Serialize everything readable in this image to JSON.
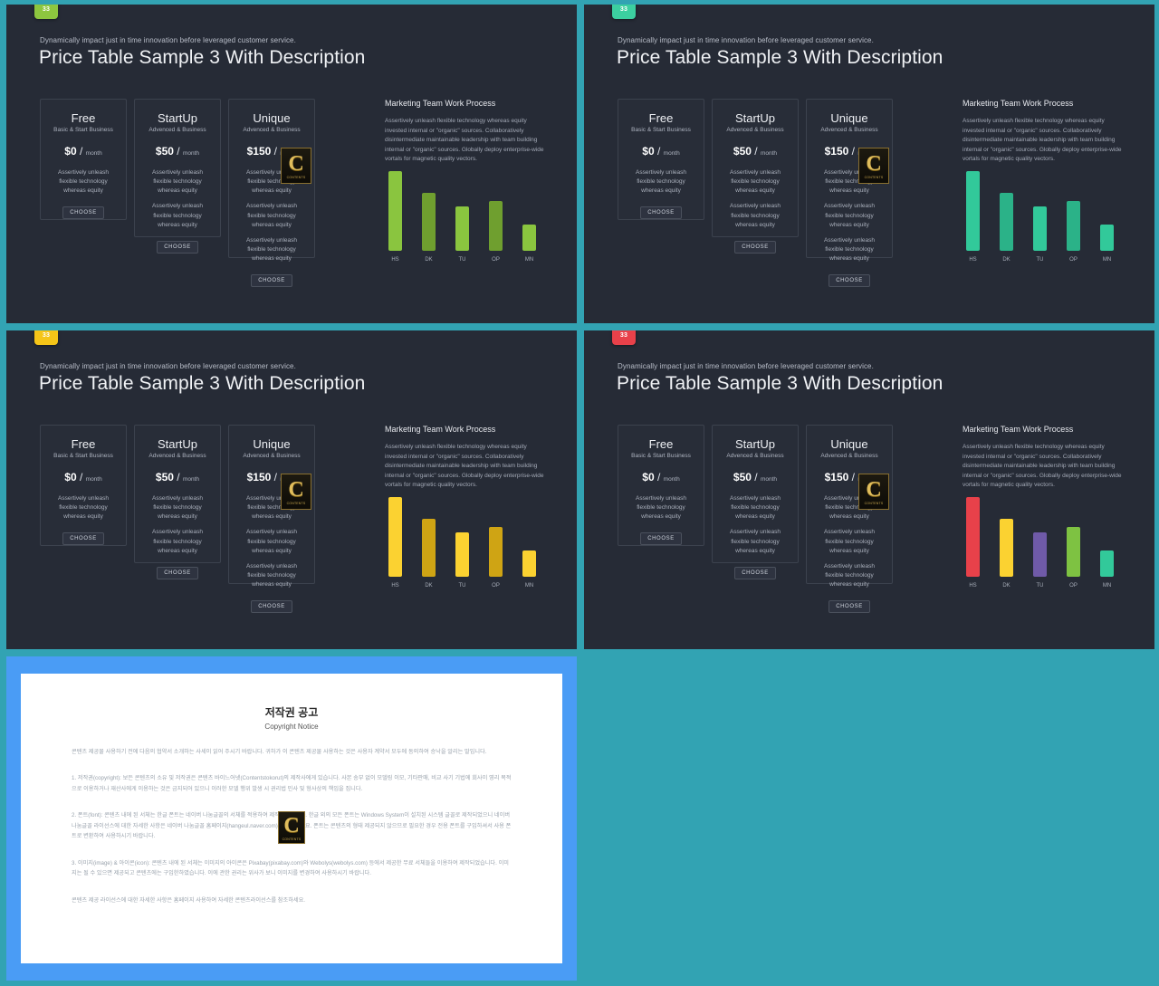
{
  "slide": {
    "kicker": "Dynamically impact just in time innovation  before leveraged customer service.",
    "headline": "Price Table Sample 3 With Description"
  },
  "badges": [
    {
      "label": "33",
      "color": "#8dc63f"
    },
    {
      "label": "33",
      "color": "#3ccfa0"
    },
    {
      "label": "33",
      "color": "#f5c518"
    },
    {
      "label": "33",
      "color": "#e8414a"
    }
  ],
  "cards": [
    {
      "title": "Free",
      "subtitle": "Basic & Start Business",
      "price": "$0",
      "slash": "/",
      "period": "month",
      "features": [
        "Assertively unleash flexible technology whereas equity"
      ],
      "cta": "CHOOSE"
    },
    {
      "title": "StartUp",
      "subtitle": "Advenced & Business",
      "price": "$50",
      "slash": "/",
      "period": "month",
      "features": [
        "Assertively unleash flexible technology whereas equity",
        "Assertively unleash flexible technology whereas equity"
      ],
      "cta": "CHOOSE"
    },
    {
      "title": "Unique",
      "subtitle": "Advenced & Business",
      "price": "$150",
      "slash": "/",
      "period": "month",
      "features": [
        "Assertively unleash flexible technology whereas equity",
        "Assertively unleash flexible technology whereas equity",
        "Assertively unleash flexible technology whereas equity"
      ],
      "cta": "CHOOSE"
    }
  ],
  "watermark": {
    "letter": "C",
    "caption": "CONTENTS"
  },
  "chart_common": {
    "title": "Marketing  Team Work Process",
    "description": "Assertively unleash flexible technology whereas equity invested internal or \"organic\" sources. Collaboratively disintermediate maintainable leadership with team building internal or \"organic\" sources. Globally deploy enterprise-wide vortals for magnetic quality vectors."
  },
  "chart_data": [
    {
      "type": "bar",
      "panel": 1,
      "title": "Marketing  Team Work Process",
      "categories": [
        "HS",
        "DK",
        "TU",
        "OP",
        "MN"
      ],
      "values": [
        100,
        72,
        55,
        62,
        33
      ],
      "colors": [
        "#8ac53f",
        "#6f9f2f",
        "#8ac53f",
        "#6f9f2f",
        "#8ac53f"
      ],
      "ylim": [
        0,
        100
      ],
      "xlabel": "",
      "ylabel": "",
      "grid": false,
      "legend": "none"
    },
    {
      "type": "bar",
      "panel": 2,
      "title": "Marketing  Team Work Process",
      "categories": [
        "HS",
        "DK",
        "TU",
        "OP",
        "MN"
      ],
      "values": [
        100,
        72,
        55,
        62,
        33
      ],
      "colors": [
        "#32c99a",
        "#2bb288",
        "#32c99a",
        "#2bb288",
        "#32c99a"
      ],
      "ylim": [
        0,
        100
      ],
      "xlabel": "",
      "ylabel": "",
      "grid": false,
      "legend": "none"
    },
    {
      "type": "bar",
      "panel": 3,
      "title": "Marketing  Team Work Process",
      "categories": [
        "HS",
        "DK",
        "TU",
        "OP",
        "MN"
      ],
      "values": [
        100,
        72,
        55,
        62,
        33
      ],
      "colors": [
        "#fbd231",
        "#cfa414",
        "#fbd231",
        "#cfa414",
        "#fbd231"
      ],
      "ylim": [
        0,
        100
      ],
      "xlabel": "",
      "ylabel": "",
      "grid": false,
      "legend": "none"
    },
    {
      "type": "bar",
      "panel": 4,
      "title": "Marketing  Team Work Process",
      "categories": [
        "HS",
        "DK",
        "TU",
        "OP",
        "MN"
      ],
      "values": [
        100,
        72,
        55,
        62,
        33
      ],
      "colors": [
        "#e8414a",
        "#fbd231",
        "#6f5aa8",
        "#7ec242",
        "#32c99a"
      ],
      "ylim": [
        0,
        100
      ],
      "xlabel": "",
      "ylabel": "",
      "grid": false,
      "legend": "none"
    }
  ],
  "document": {
    "heading_ko": "저작권 공고",
    "heading_en": "Copyright Notice",
    "intro": "콘텐츠 제공물 사용하기 전에 다음의 협약서 소개하는 사세이 읽어 주시기 바랍니다. 귀하가 이 콘텐츠 제공물 사용하는 것은 사용자 계약서 모두에 동의하여 승낙을 알리는 말입니다.",
    "item1": "1. 저작권(copyright): 보든 콘텐츠의 소유 및 저작권은 콘텐츠 바이느어넷(Contentstokorut)의 제작사에게 있습니다. 사본 송부 없이 모델링 이모, 기타판매, 비교 사기 기법에 회사이 영리 목적으로 이용하거나 재산사에게 이용하는 것은 금지되어 있으니 이러한 모델 행위 발생 시 권리법 민사 및 형사상의 책임을 집니다.",
    "item2": "2. 폰트(font): 콘텐츠 내에 된 서체는 한글 폰트는 네이버 나눔글꼴의 서체를 적용하여 제작되었습니다. 한글 외의 모든 폰트는 Windows System이 설치된 시스템 글꼴로 제작되었으니 네이버 나눔글꼴 라이선스에 대한 자세한 사항은 네이버 나눔글꼴 홈페이지(hangeul.naver.com)를 참조하세요. 폰트는 콘텐츠의 형태 제공되지 않으므로 필요한 경우 전용 폰트를 구입하셔서 사용 폰트로 변환하여 사용하시기 바랍니다.",
    "item3": "3. 이미지(image) & 아이콘(icon): 콘텐츠 내에 된 서체는 이미지의 아이콘은 Pixabay(pixabay.com)와 Webolys(webolys.com) 등에서 제공한 무료 서체들을 이용하여 제작되었습니다. 이미지는 될 수 있으면 제공되고 콘텐츠에는 구입한하였습니다. 이에 관한 권리는 위사가 보니 이미지를 변경하여 사용하시기 바랍니다.",
    "footer": "콘텐츠 제공 라이선스에 대한 자세한 사항은 홈페이지 사용하여 자세한 콘텐츠라이선스를 참조하세요."
  }
}
